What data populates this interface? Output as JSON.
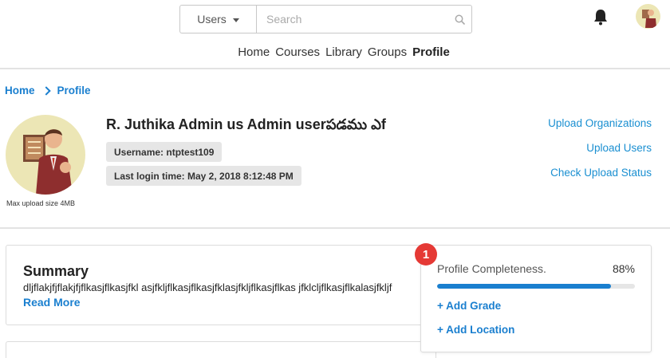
{
  "header": {
    "scope_label": "Users",
    "search_placeholder": "Search",
    "nav": [
      {
        "label": "Home"
      },
      {
        "label": "Courses"
      },
      {
        "label": "Library"
      },
      {
        "label": "Groups"
      },
      {
        "label": "Profile",
        "active": true
      }
    ],
    "icons": {
      "bell": "bell-icon",
      "search": "search-icon",
      "dropdown": "caret-down-icon"
    }
  },
  "breadcrumb": {
    "items": [
      "Home",
      "Profile"
    ]
  },
  "profile": {
    "name": "R. Juthika Admin us  Admin userపడము ఎf",
    "username": "Username: ntptest109",
    "last_login": "Last login time: May 2, 2018 8:12:48 PM",
    "upload_note": "Max upload size 4MB"
  },
  "actions": {
    "upload_organizations": "Upload Organizations",
    "upload_users": "Upload Users",
    "check_upload_status": "Check Upload Status"
  },
  "summary": {
    "title": "Summary",
    "text": "dljflakjfjflakjfjflkasjflkasjfkl asjfkljflkasjflkasjfklasjfkljflkasjflkas jfklcljflkasjflkalasjfkljf",
    "read_more": "Read More"
  },
  "completeness": {
    "label": "Profile Completeness.",
    "percent_text": "88%",
    "percent": 88,
    "badge": "1",
    "add_grade": "+ Add Grade",
    "add_location": "+ Add Location"
  },
  "colors": {
    "accent": "#1a7fcf",
    "badge": "#e53935",
    "avatar_bg": "#ece6b5"
  }
}
